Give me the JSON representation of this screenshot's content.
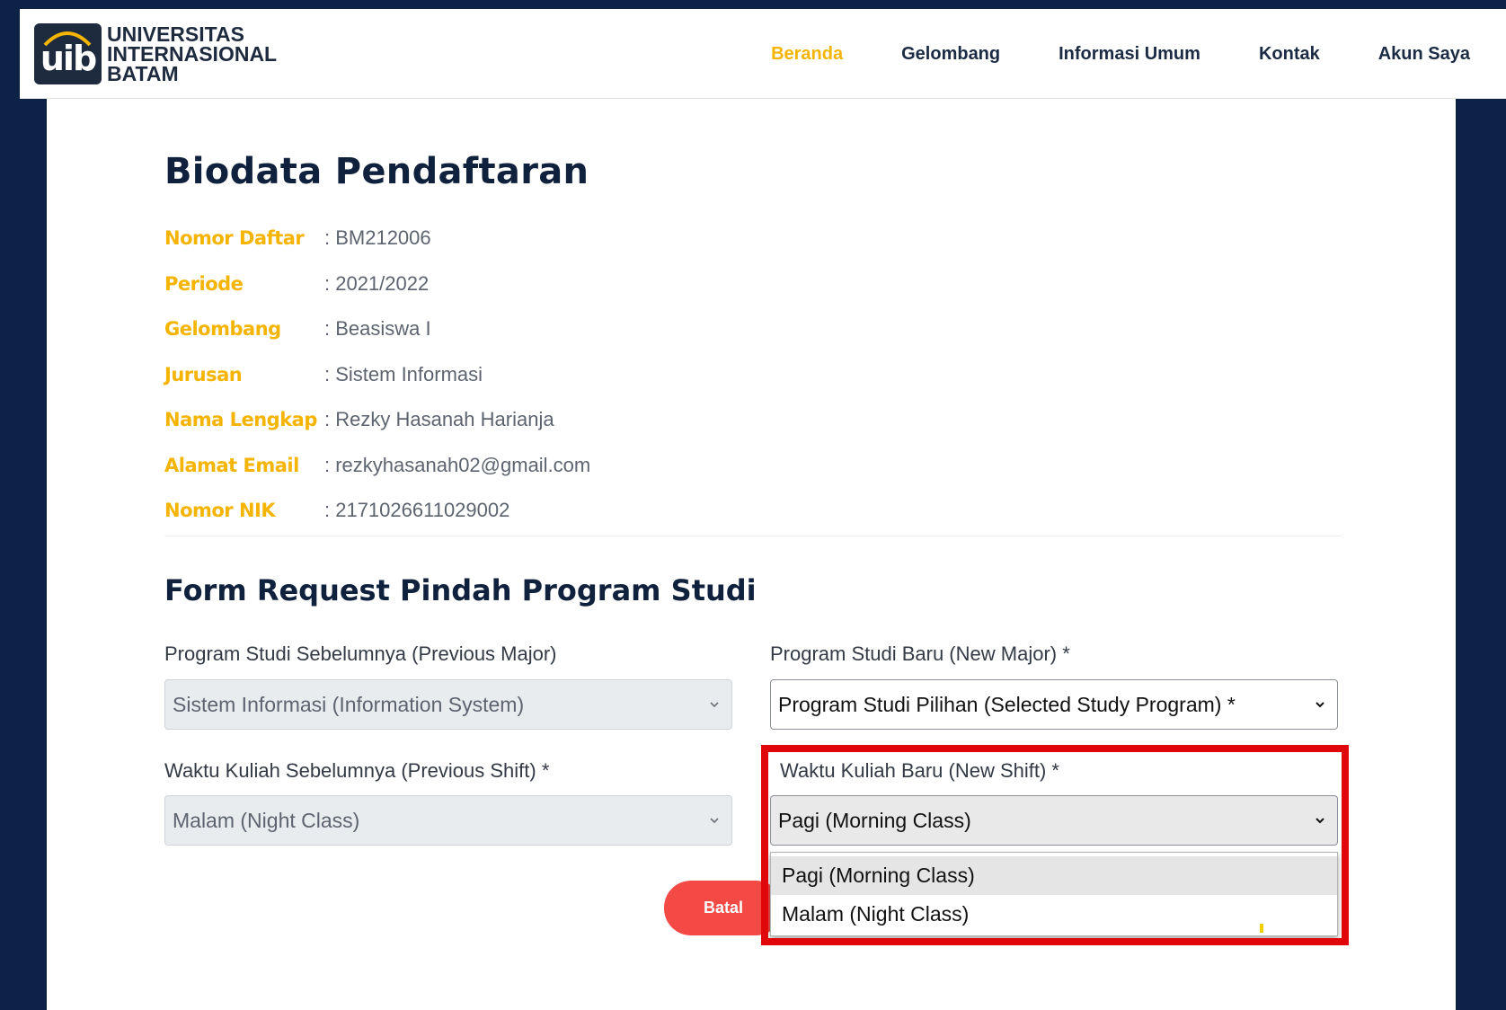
{
  "logo": {
    "mark": "uib",
    "line1": "UNIVERSITAS",
    "line2": "INTERNASIONAL",
    "line3": "BATAM"
  },
  "nav": {
    "items": [
      {
        "label": "Beranda",
        "active": true
      },
      {
        "label": "Gelombang",
        "active": false
      },
      {
        "label": "Informasi Umum",
        "active": false
      },
      {
        "label": "Kontak",
        "active": false
      },
      {
        "label": "Akun Saya",
        "active": false
      }
    ]
  },
  "page": {
    "title": "Biodata Pendaftaran"
  },
  "biodata": [
    {
      "label": "Nomor Daftar",
      "value": ": BM212006"
    },
    {
      "label": "Periode",
      "value": ": 2021/2022"
    },
    {
      "label": "Gelombang",
      "value": ": Beasiswa I"
    },
    {
      "label": "Jurusan",
      "value": ": Sistem Informasi"
    },
    {
      "label": "Nama Lengkap",
      "value": ": Rezky Hasanah Harianja"
    },
    {
      "label": "Alamat Email",
      "value": ": rezkyhasanah02@gmail.com"
    },
    {
      "label": "Nomor NIK",
      "value": ": 2171026611029002"
    }
  ],
  "form": {
    "title": "Form Request Pindah Program Studi",
    "previous_major": {
      "label": "Program Studi Sebelumnya (Previous Major)",
      "value": "Sistem Informasi (Information System)"
    },
    "new_major": {
      "label": "Program Studi Baru (New Major) *",
      "value": "Program Studi Pilihan (Selected Study Program) *"
    },
    "previous_shift": {
      "label": "Waktu Kuliah Sebelumnya (Previous Shift) *",
      "value": "Malam (Night Class)"
    },
    "new_shift": {
      "label": "Waktu Kuliah Baru (New Shift) *",
      "value": "Pagi (Morning Class)",
      "options": [
        "Pagi (Morning Class)",
        "Malam (Night Class)"
      ],
      "highlighted_option": "Pagi (Morning Class)"
    },
    "cancel_label": "Batal"
  },
  "colors": {
    "accent": "#f4b400",
    "navy": "#0c2246",
    "cancel": "#f34a46",
    "submit": "#2c9cf3",
    "highlight": "#e0070b"
  }
}
